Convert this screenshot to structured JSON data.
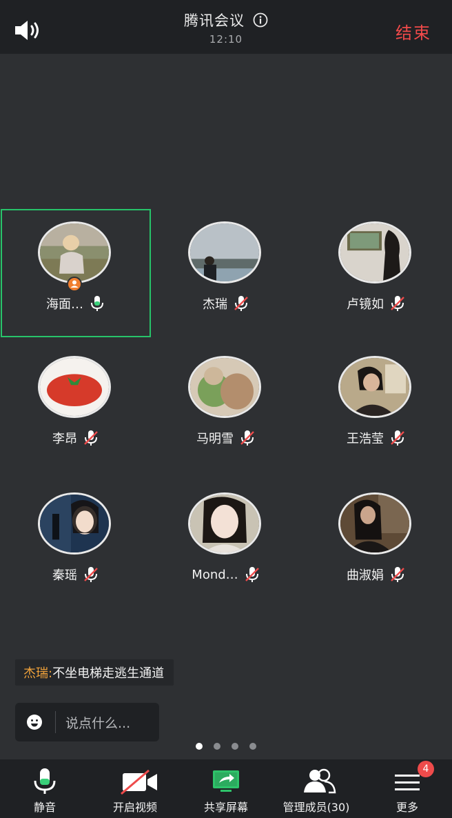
{
  "header": {
    "title": "腾讯会议",
    "time": "12:10",
    "end_label": "结束"
  },
  "participants": [
    {
      "name": "海面…",
      "mic": "on",
      "host": true,
      "active": true
    },
    {
      "name": "杰瑞",
      "mic": "muted"
    },
    {
      "name": "卢镜如",
      "mic": "muted"
    },
    {
      "name": "李昂",
      "mic": "muted"
    },
    {
      "name": "马明雪",
      "mic": "muted"
    },
    {
      "name": "王浩莹",
      "mic": "muted"
    },
    {
      "name": "秦瑶",
      "mic": "muted"
    },
    {
      "name": "Mond…",
      "mic": "muted"
    },
    {
      "name": "曲淑娟",
      "mic": "muted"
    }
  ],
  "chat": {
    "last_sender": "杰瑞:",
    "last_message": " 不坐电梯走逃生通道",
    "input_placeholder": "说点什么..."
  },
  "pager": {
    "pages": 4,
    "current": 1
  },
  "toolbar": {
    "mute_label": "静音",
    "video_label": "开启视频",
    "share_label": "共享屏幕",
    "members_label": "管理成员(30)",
    "more_label": "更多",
    "more_badge": "4"
  },
  "colors": {
    "background": "#2e3033",
    "bar": "#1f2124",
    "end": "#f24a4a",
    "active_outline": "#27c46a",
    "chat_sender": "#f0a23b",
    "badge": "#ee4b4b"
  }
}
